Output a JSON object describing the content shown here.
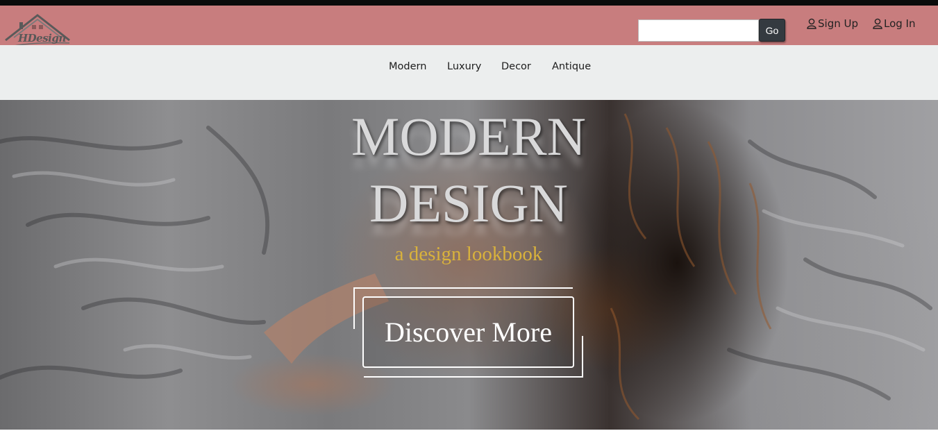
{
  "brand": {
    "logo_text": "HDesign",
    "accent_color": "#c87d7e"
  },
  "search": {
    "value": "",
    "placeholder": "",
    "go_label": "Go"
  },
  "auth": {
    "signup_label": "Sign Up",
    "login_label": "Log In",
    "icon": "user-icon"
  },
  "nav": {
    "items": [
      {
        "label": "Modern"
      },
      {
        "label": "Luxury"
      },
      {
        "label": "Decor"
      },
      {
        "label": "Antique"
      }
    ]
  },
  "hero": {
    "title_line1": "MODERN",
    "title_line2": "DESIGN",
    "subtitle": "a design lookbook",
    "subtitle_color": "#d9b23c",
    "cta_label": "Discover More"
  }
}
